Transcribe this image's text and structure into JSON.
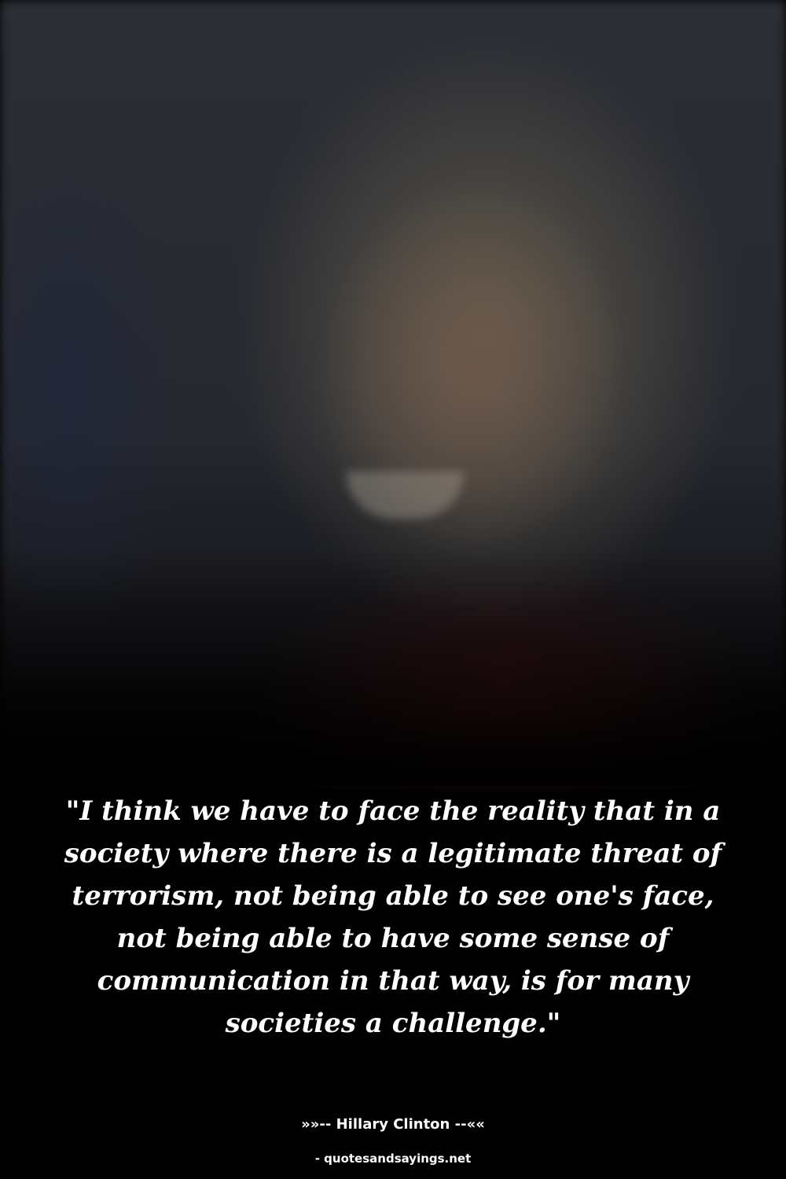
{
  "quote": "\"I think we have to face the reality that in a society where there is a legitimate threat of terrorism, not being able to see one's face, not being able to have some sense of communication in that way, is for many societies a challenge.\"",
  "author": "»»-- Hillary Clinton --««",
  "source": "- quotesandsayings.net"
}
